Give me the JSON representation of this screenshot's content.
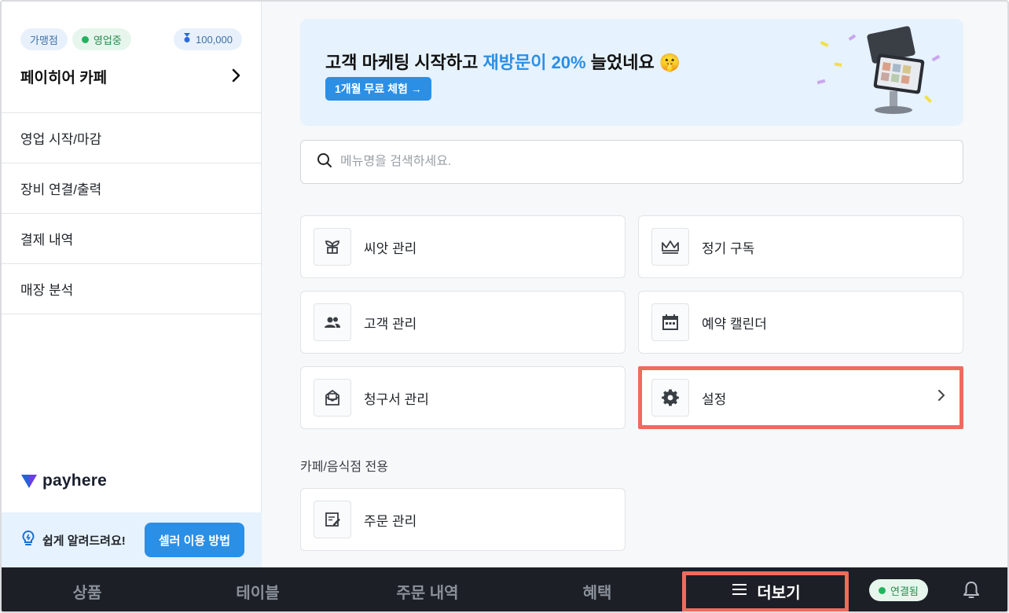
{
  "sidebar": {
    "chip_type": "가맹점",
    "chip_status": "영업중",
    "chip_points": "100,000",
    "store_name": "페이히어 카페",
    "menu": [
      {
        "label": "영업 시작/마감"
      },
      {
        "label": "장비 연결/출력"
      },
      {
        "label": "결제 내역"
      },
      {
        "label": "매장 분석"
      }
    ],
    "logo_text": "payhere",
    "help_text": "쉽게 알려드려요!",
    "help_button": "셀러 이용 방법"
  },
  "banner": {
    "title_prefix": "고객 마케팅 시작하고 ",
    "title_highlight": "재방문이 20%",
    "title_suffix": " 늘었네요 🤫",
    "button": "1개월 무료 체험 →"
  },
  "search": {
    "placeholder": "메뉴명을 검색하세요.",
    "value": ""
  },
  "cards": [
    {
      "label": "씨앗 관리",
      "icon": "sprout-icon"
    },
    {
      "label": "정기 구독",
      "icon": "crown-icon"
    },
    {
      "label": "고객 관리",
      "icon": "people-icon"
    },
    {
      "label": "예약 캘린더",
      "icon": "calendar-icon"
    },
    {
      "label": "청구서 관리",
      "icon": "invoice-icon"
    },
    {
      "label": "설정",
      "icon": "gear-icon",
      "arrow": "›"
    }
  ],
  "section": {
    "title": "카페/음식점 전용",
    "cards": [
      {
        "label": "주문 관리",
        "icon": "order-edit-icon"
      }
    ]
  },
  "bottom_nav": {
    "items": [
      {
        "label": "상품"
      },
      {
        "label": "테이블"
      },
      {
        "label": "주문 내역"
      },
      {
        "label": "혜택"
      },
      {
        "label": "더보기"
      }
    ],
    "connection": "연결됨"
  },
  "colors": {
    "accent": "#2b8fe6",
    "highlight": "#ef6b5e",
    "nav_bg": "#1c1f26",
    "status_green": "#22b35e"
  }
}
